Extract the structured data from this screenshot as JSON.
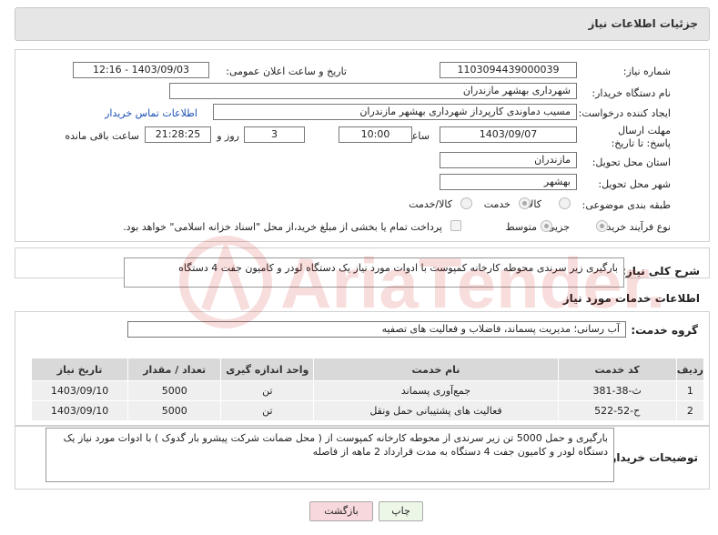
{
  "header": {
    "title": "جزئیات اطلاعات نیاز"
  },
  "form": {
    "need_number": {
      "label": "شماره نیاز:",
      "value": "1103094439000039"
    },
    "announce": {
      "label": "تاریخ و ساعت اعلان عمومی:",
      "value": "1403/09/03 - 12:16"
    },
    "buyer_org": {
      "label": "نام دستگاه خریدار:",
      "value": "شهرداری بهشهر مازندران"
    },
    "requester": {
      "label": "ایجاد کننده درخواست:",
      "value": "مسیب دماوندی کارپرداز شهرداری بهشهر مازندران",
      "contact_link": "اطلاعات تماس خریدار"
    },
    "deadline": {
      "label": "مهلت ارسال پاسخ: تا تاریخ:",
      "date": "1403/09/07",
      "time_label": "ساعت",
      "time": "10:00",
      "days": "3",
      "days_label": "روز و",
      "remaining": "21:28:25",
      "remaining_label": "ساعت باقی مانده"
    },
    "province": {
      "label": "استان محل تحویل:",
      "value": "مازندران"
    },
    "city": {
      "label": "شهر محل تحویل:",
      "value": "بهشهر"
    },
    "category": {
      "label": "طبقه بندی موضوعی:",
      "options": [
        "کالا",
        "خدمت",
        "کالا/خدمت"
      ],
      "selected": "خدمت"
    },
    "process": {
      "label": "نوع فرآیند خرید :",
      "options": [
        "جزیی",
        "متوسط"
      ],
      "selected": "جزیی",
      "treasury_text": "پرداخت تمام یا بخشی از مبلغ خرید،از محل \"اسناد خزانه اسلامی\" خواهد بود."
    }
  },
  "summary": {
    "label": "شرح کلی نیاز:",
    "value": "بارگیری زیر سرندی محوطه کارخانه کمپوست با ادوات مورد نیاز یک دستگاه لودر و کامیون جفت 4 دستگاه"
  },
  "services": {
    "title": "اطلاعات خدمات مورد نیاز",
    "group_label": "گروه خدمت:",
    "group_value": "آب رسانی؛ مدیریت پسماند، فاضلاب و فعالیت های تصفیه",
    "columns": [
      "ردیف",
      "کد خدمت",
      "نام خدمت",
      "واحد اندازه گیری",
      "تعداد / مقدار",
      "تاریخ نیاز"
    ],
    "rows": [
      [
        "1",
        "ث-38-381",
        "جمع‌آوری پسماند",
        "تن",
        "5000",
        "1403/09/10"
      ],
      [
        "2",
        "ح-52-522",
        "فعالیت های پشتیبانی حمل ونقل",
        "تن",
        "5000",
        "1403/09/10"
      ]
    ]
  },
  "buyer_notes": {
    "label": "توضیحات خریدار:",
    "value": "بارگیری  و حمل  5000 تن زیر سرندی از محوطه کارخانه کمپوست از ( محل ضمانت شرکت پیشرو بار گدوک ) با ادوات مورد نیاز یک دستگاه لودر و کامیون جفت 4 دستگاه به مدت قرارداد 2 ماهه از فاصله"
  },
  "buttons": {
    "print": "چاپ",
    "back": "بازگشت"
  },
  "watermark": {
    "text": "AriaTender.neT"
  },
  "colors": {
    "link": "#1a4fb5",
    "back_btn": "#f7d8dc",
    "print_btn": "#ecf7e8"
  }
}
